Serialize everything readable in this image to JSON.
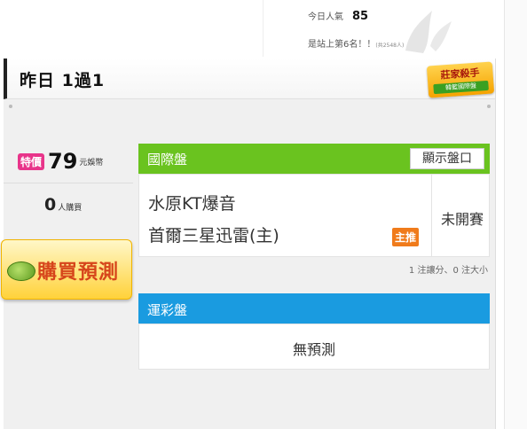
{
  "stats": {
    "today_label": "今日人氣",
    "today_value": "85",
    "rank_text": "是站上第6名！！",
    "rank_note": "(共2548人)"
  },
  "header": {
    "title": "昨日 1過1",
    "badge_line1": "莊家殺手",
    "badge_line2": "韓籃國際盤"
  },
  "pricing": {
    "special_tag": "特價",
    "price": "79",
    "unit": "元娛幣"
  },
  "buyers": {
    "count": "0",
    "label": "人購買"
  },
  "buy_button": {
    "label": "購買預測"
  },
  "international": {
    "title": "國際盤",
    "show_odds_label": "顯示盤口",
    "team_away": "水原KT爆音",
    "team_home": "首爾三星迅雷(主)",
    "tag": "主推",
    "status": "未開賽",
    "summary": "1 注讓分、0 注大小"
  },
  "lottery": {
    "title": "運彩盤",
    "empty_text": "無預測"
  },
  "colors": {
    "green_header": "#6ac31f",
    "blue_header": "#1a9be0",
    "tag_orange": "#f07b1b",
    "special_pink": "#e8348a",
    "buy_red": "#d6451b"
  }
}
